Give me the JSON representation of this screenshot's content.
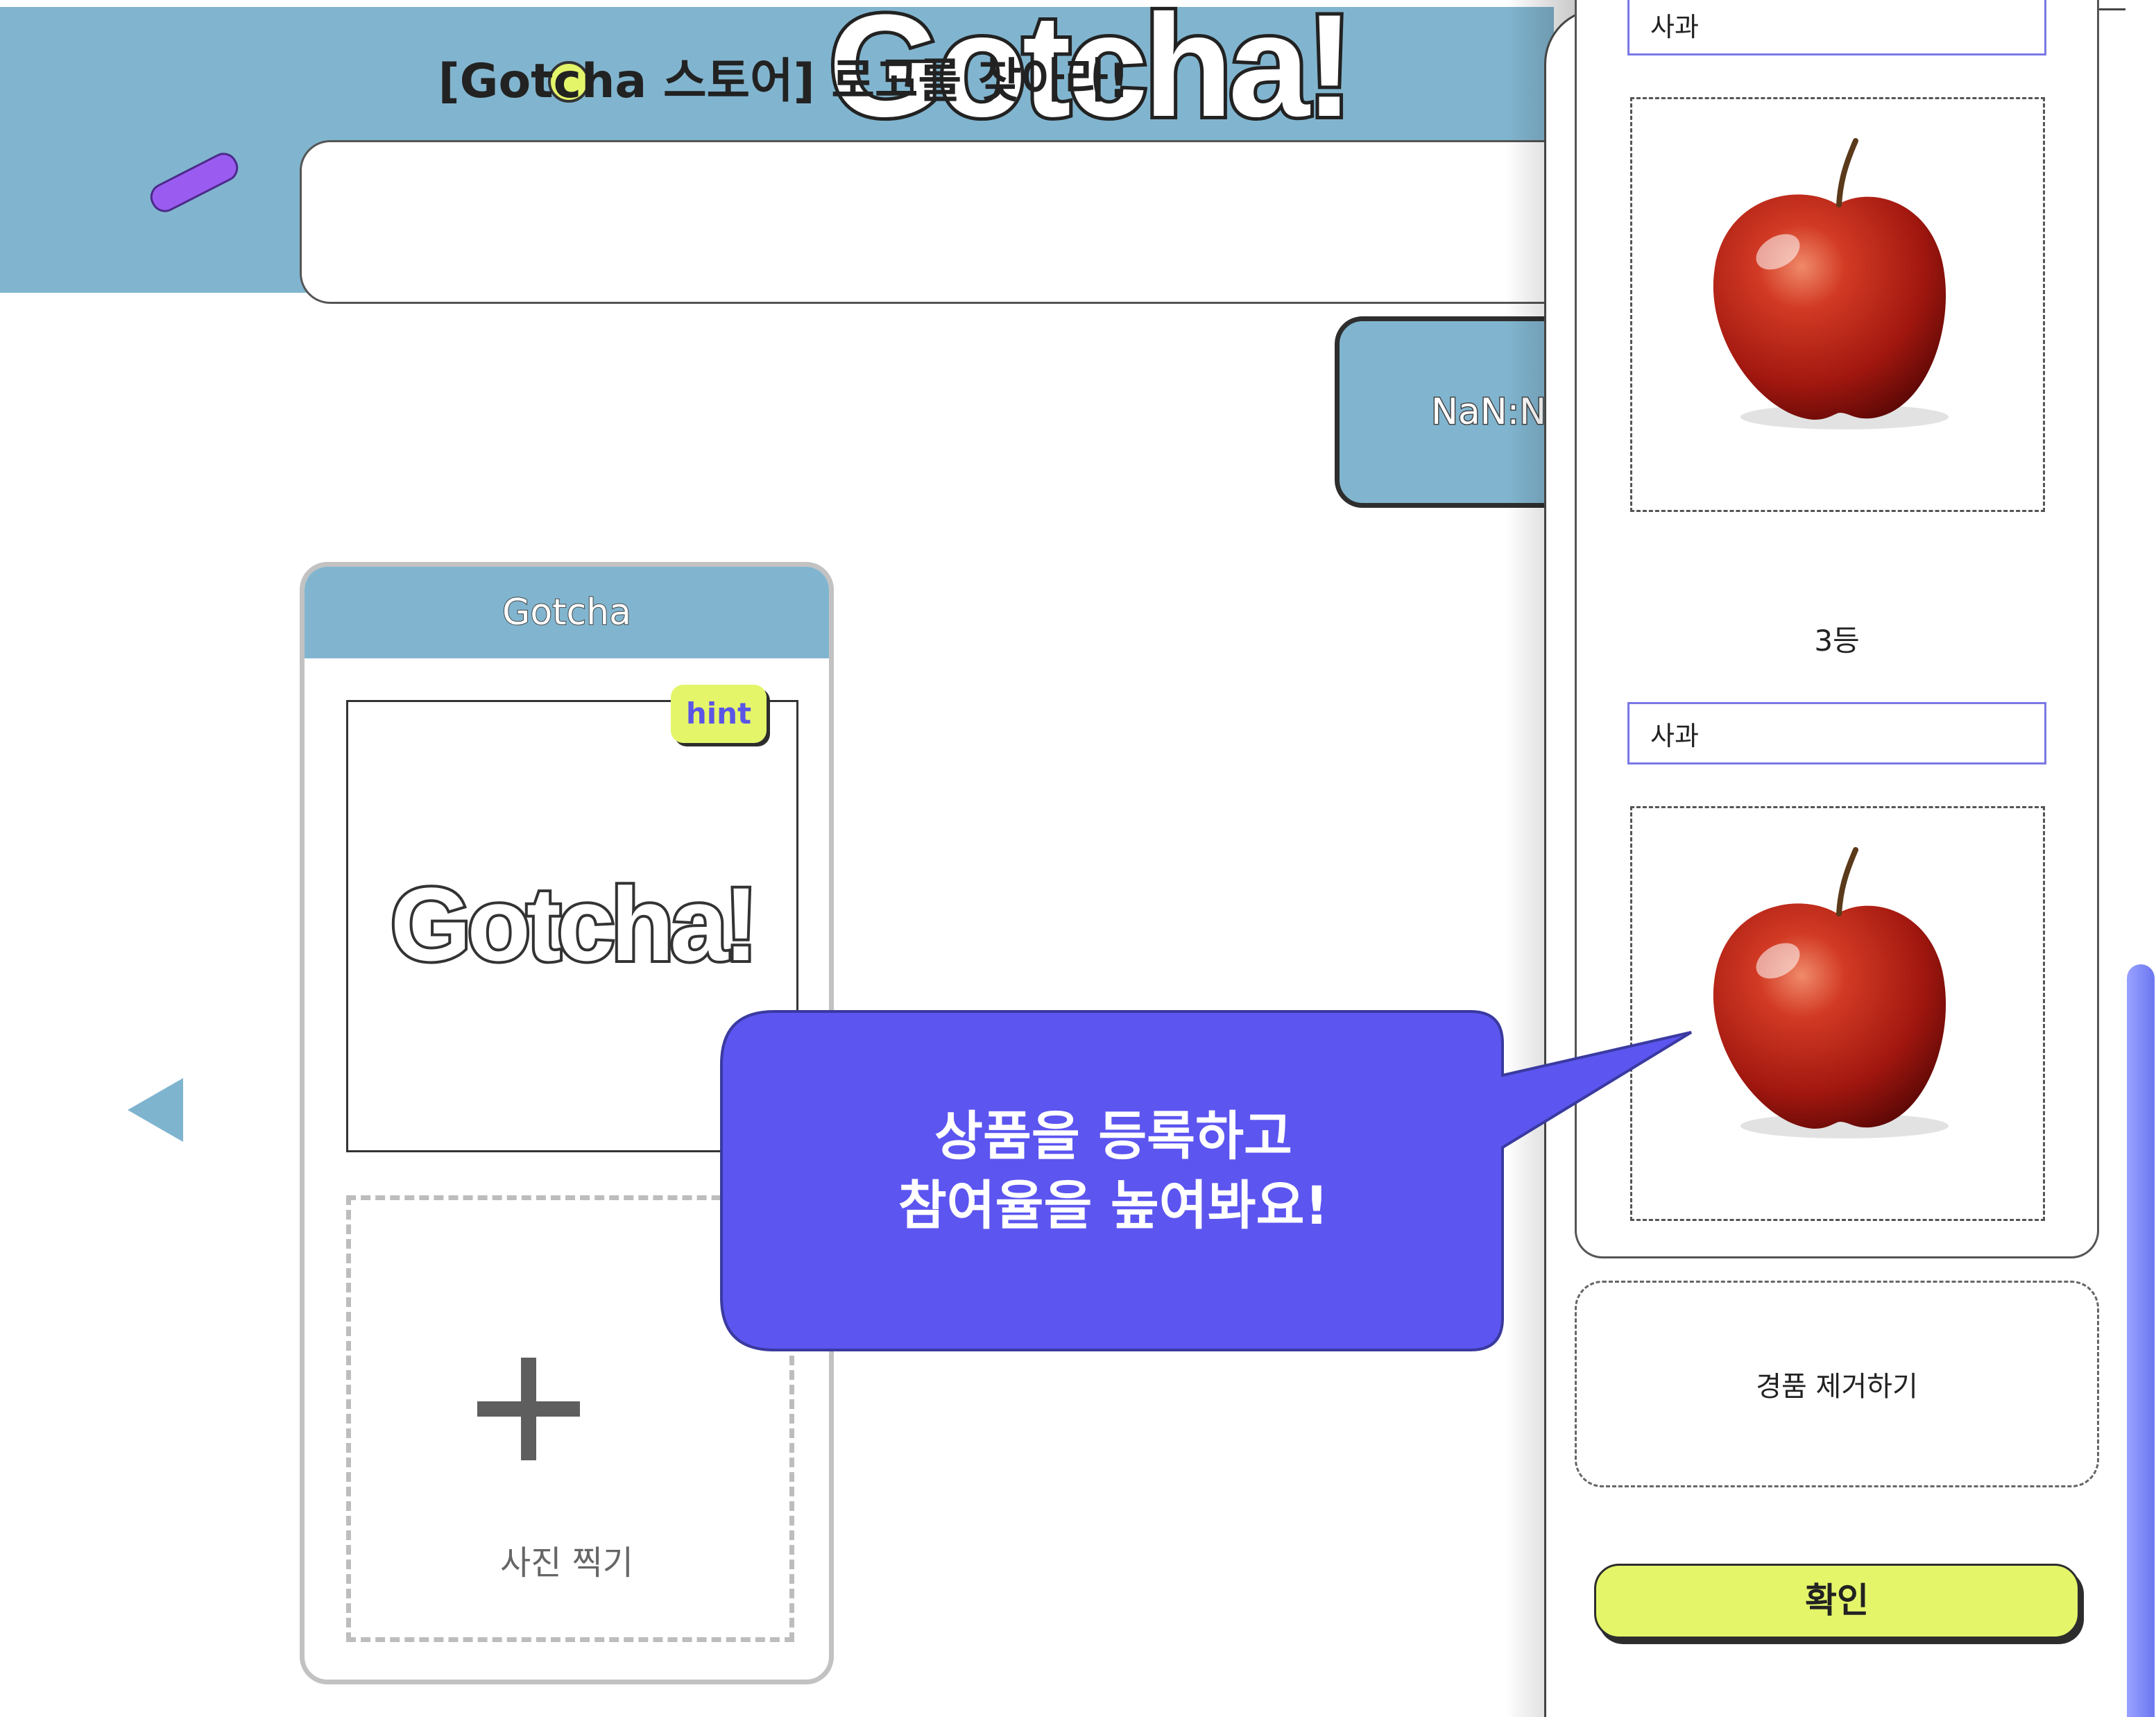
{
  "header": {
    "logo_text": "Gotcha!",
    "mission_title": "[Gotcha 스토어] 로고를 찾아라!",
    "timer": "NaN:NaN"
  },
  "card": {
    "title": "Gotcha",
    "hint_label": "hint",
    "image_logo_text": "Gotcha!",
    "photo_label": "사진 찍기",
    "plus_icon": "plus-icon"
  },
  "navigation": {
    "prev_icon": "triangle-left-icon"
  },
  "tooltip": {
    "line1": "상품을 등록하고",
    "line2": "참여율을 높여봐요!"
  },
  "prize_panel": {
    "prizes": [
      {
        "name_value": "사과"
      },
      {
        "rank_label": "3등",
        "name_value": "사과"
      }
    ],
    "remove_label": "경품 제거하기",
    "confirm_label": "확인"
  },
  "colors": {
    "header_blue": "#81b5cf",
    "accent_yellow": "#e4f56a",
    "bubble_purple": "#5c55f0",
    "pill_purple": "#9a5cf0"
  }
}
